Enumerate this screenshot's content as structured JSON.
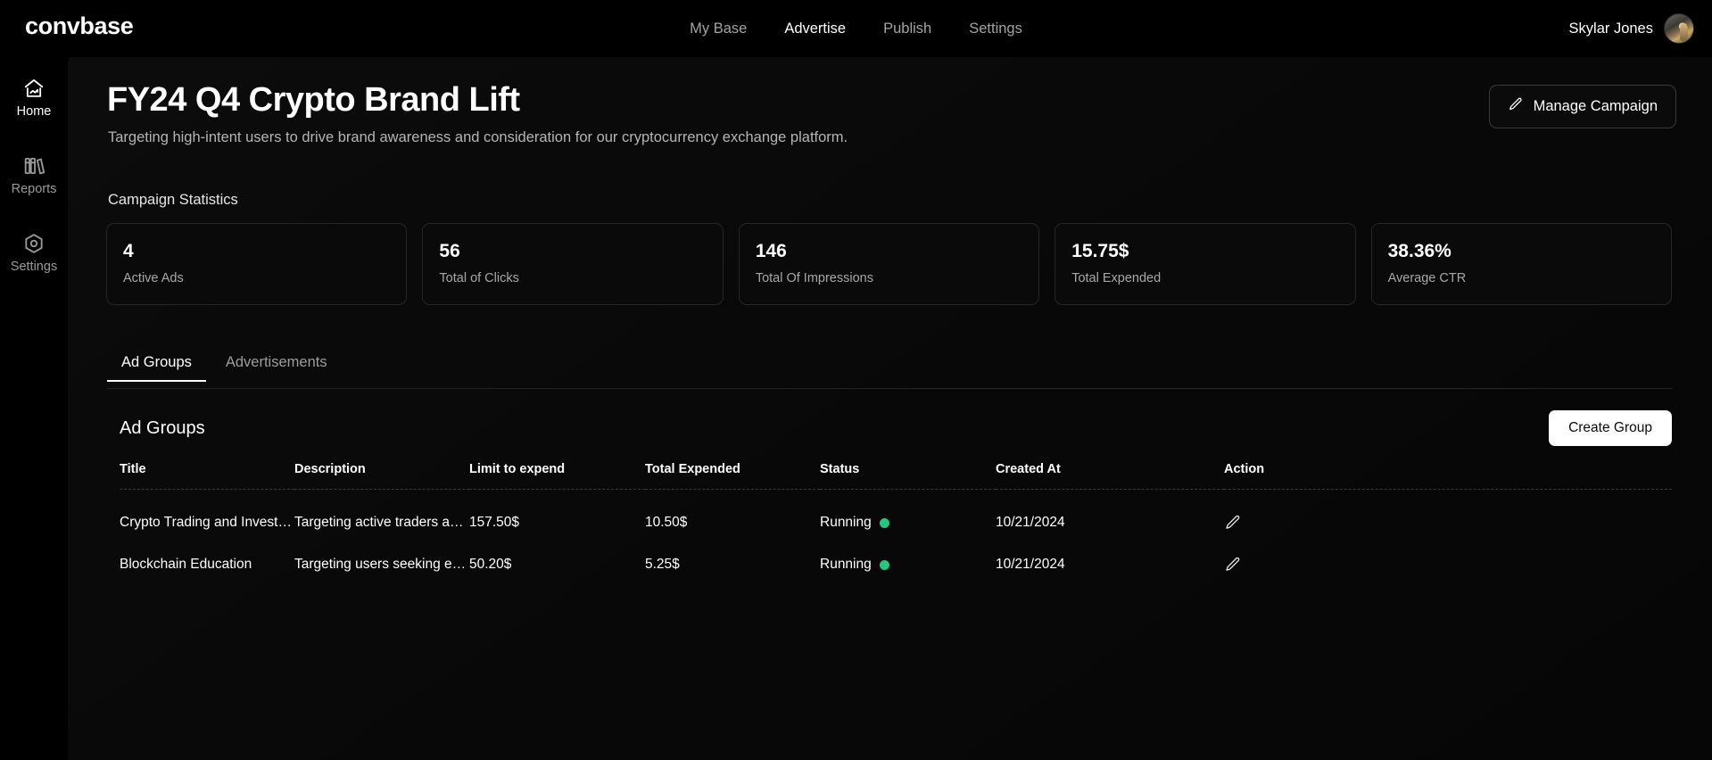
{
  "topbar": {
    "brand": "convbase",
    "nav": [
      {
        "label": "My Base",
        "active": false
      },
      {
        "label": "Advertise",
        "active": true
      },
      {
        "label": "Publish",
        "active": false
      },
      {
        "label": "Settings",
        "active": false
      }
    ],
    "user_name": "Skylar Jones",
    "avatar_icon": "user-avatar-photo"
  },
  "sidebar": {
    "items": [
      {
        "label": "Home",
        "icon": "home-icon",
        "active": true
      },
      {
        "label": "Reports",
        "icon": "books-icon",
        "active": false
      },
      {
        "label": "Settings",
        "icon": "hexagon-gear-icon",
        "active": false
      }
    ]
  },
  "page": {
    "title": "FY24 Q4 Crypto Brand Lift",
    "subtitle": "Targeting high-intent users to drive brand awareness and consideration for our cryptocurrency exchange platform.",
    "manage_button": "Manage Campaign",
    "manage_button_icon": "pencil-icon",
    "stats_section_label": "Campaign Statistics"
  },
  "stats": [
    {
      "value": "4",
      "label": "Active Ads"
    },
    {
      "value": "56",
      "label": "Total of Clicks"
    },
    {
      "value": "146",
      "label": "Total Of Impressions"
    },
    {
      "value": "15.75$",
      "label": "Total Expended"
    },
    {
      "value": "38.36%",
      "label": "Average CTR"
    }
  ],
  "tabs": [
    {
      "label": "Ad Groups",
      "active": true
    },
    {
      "label": "Advertisements",
      "active": false
    }
  ],
  "table": {
    "title": "Ad Groups",
    "create_button": "Create Group",
    "columns": [
      "Title",
      "Description",
      "Limit to expend",
      "Total Expended",
      "Status",
      "Created At",
      "Action"
    ],
    "rows": [
      {
        "title": "Crypto Trading and Invest…",
        "description": "Targeting active traders a…",
        "limit": "157.50$",
        "expended": "10.50$",
        "status": "Running",
        "status_color": "#22c87e",
        "created_at": "10/21/2024",
        "action_icon": "pencil-icon"
      },
      {
        "title": "Blockchain Education",
        "description": "Targeting users seeking e…",
        "limit": "50.20$",
        "expended": "5.25$",
        "status": "Running",
        "status_color": "#22c87e",
        "created_at": "10/21/2024",
        "action_icon": "pencil-icon"
      }
    ]
  }
}
